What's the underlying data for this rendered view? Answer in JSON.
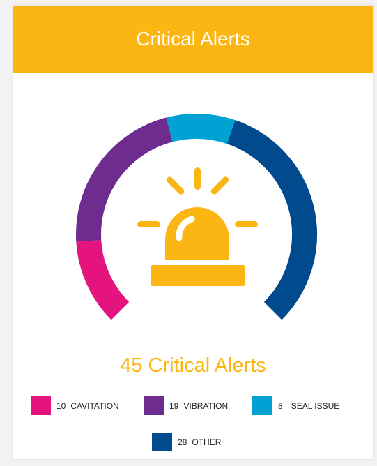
{
  "header": {
    "title": "Critical Alerts"
  },
  "summary": {
    "total_label": "45 Critical Alerts"
  },
  "icon": "alarm-siren-icon",
  "colors": {
    "header": "#fbb614",
    "icon": "#fbb614",
    "total_text": "#fbb614",
    "cavitation": "#e4137e",
    "vibration": "#6e2c8f",
    "seal_issue": "#00a2d3",
    "other": "#004a8d"
  },
  "chart_data": {
    "type": "pie",
    "variant": "semicircle-gauge",
    "categories": [
      "CAVITATION",
      "VIBRATION",
      "SEAL ISSUE",
      "OTHER"
    ],
    "values": [
      10,
      19,
      8,
      28
    ],
    "legend": [
      "10",
      "19",
      "8",
      "28"
    ]
  },
  "legend": [
    {
      "count": "10",
      "label": "CAVITATION",
      "color": "#e4137e"
    },
    {
      "count": "19",
      "label": "VIBRATION",
      "color": "#6e2c8f"
    },
    {
      "count": "8",
      "label": "SEAL ISSUE",
      "color": "#00a2d3"
    },
    {
      "count": "28",
      "label": "OTHER",
      "color": "#004a8d"
    }
  ]
}
